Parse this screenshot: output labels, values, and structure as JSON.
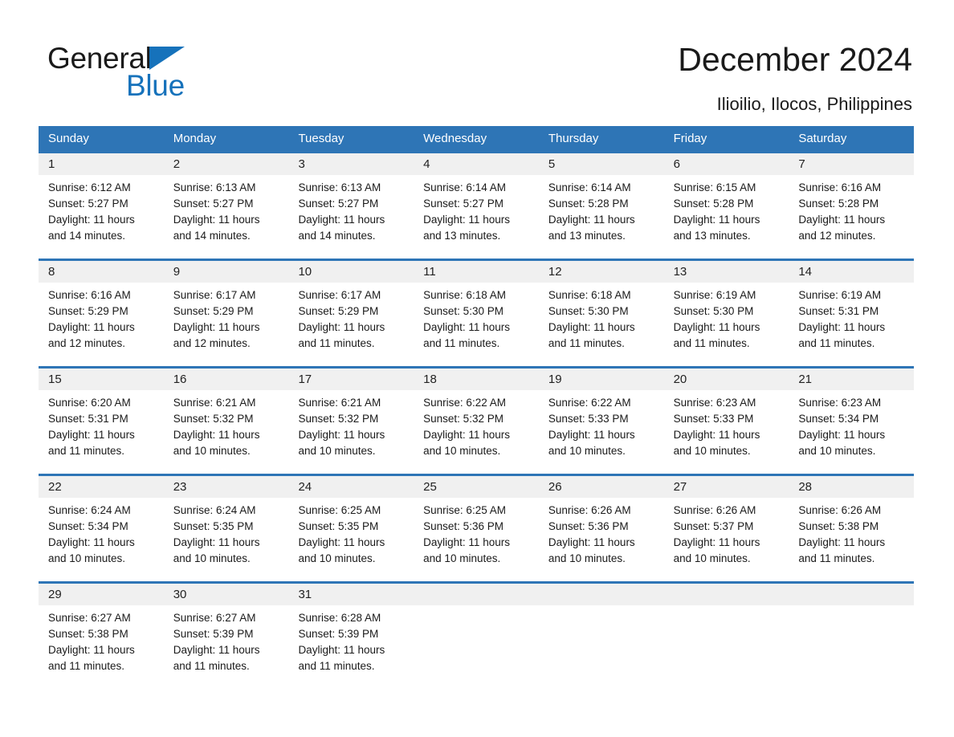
{
  "brand": {
    "word1": "General",
    "word2": "Blue",
    "triangle_color": "#1672bb",
    "text_color": "#1a1a1a"
  },
  "header": {
    "title": "December 2024",
    "subtitle": "Ilioilio, Ilocos, Philippines"
  },
  "colors": {
    "header_blue": "#2e75b6",
    "daynum_band": "#f0f0f0",
    "text": "#1a1a1a",
    "header_text": "#ffffff"
  },
  "weekdays": [
    "Sunday",
    "Monday",
    "Tuesday",
    "Wednesday",
    "Thursday",
    "Friday",
    "Saturday"
  ],
  "weeks": [
    {
      "days": [
        {
          "num": "1",
          "sunrise": "Sunrise: 6:12 AM",
          "sunset": "Sunset: 5:27 PM",
          "daylight1": "Daylight: 11 hours",
          "daylight2": "and 14 minutes."
        },
        {
          "num": "2",
          "sunrise": "Sunrise: 6:13 AM",
          "sunset": "Sunset: 5:27 PM",
          "daylight1": "Daylight: 11 hours",
          "daylight2": "and 14 minutes."
        },
        {
          "num": "3",
          "sunrise": "Sunrise: 6:13 AM",
          "sunset": "Sunset: 5:27 PM",
          "daylight1": "Daylight: 11 hours",
          "daylight2": "and 14 minutes."
        },
        {
          "num": "4",
          "sunrise": "Sunrise: 6:14 AM",
          "sunset": "Sunset: 5:27 PM",
          "daylight1": "Daylight: 11 hours",
          "daylight2": "and 13 minutes."
        },
        {
          "num": "5",
          "sunrise": "Sunrise: 6:14 AM",
          "sunset": "Sunset: 5:28 PM",
          "daylight1": "Daylight: 11 hours",
          "daylight2": "and 13 minutes."
        },
        {
          "num": "6",
          "sunrise": "Sunrise: 6:15 AM",
          "sunset": "Sunset: 5:28 PM",
          "daylight1": "Daylight: 11 hours",
          "daylight2": "and 13 minutes."
        },
        {
          "num": "7",
          "sunrise": "Sunrise: 6:16 AM",
          "sunset": "Sunset: 5:28 PM",
          "daylight1": "Daylight: 11 hours",
          "daylight2": "and 12 minutes."
        }
      ]
    },
    {
      "days": [
        {
          "num": "8",
          "sunrise": "Sunrise: 6:16 AM",
          "sunset": "Sunset: 5:29 PM",
          "daylight1": "Daylight: 11 hours",
          "daylight2": "and 12 minutes."
        },
        {
          "num": "9",
          "sunrise": "Sunrise: 6:17 AM",
          "sunset": "Sunset: 5:29 PM",
          "daylight1": "Daylight: 11 hours",
          "daylight2": "and 12 minutes."
        },
        {
          "num": "10",
          "sunrise": "Sunrise: 6:17 AM",
          "sunset": "Sunset: 5:29 PM",
          "daylight1": "Daylight: 11 hours",
          "daylight2": "and 11 minutes."
        },
        {
          "num": "11",
          "sunrise": "Sunrise: 6:18 AM",
          "sunset": "Sunset: 5:30 PM",
          "daylight1": "Daylight: 11 hours",
          "daylight2": "and 11 minutes."
        },
        {
          "num": "12",
          "sunrise": "Sunrise: 6:18 AM",
          "sunset": "Sunset: 5:30 PM",
          "daylight1": "Daylight: 11 hours",
          "daylight2": "and 11 minutes."
        },
        {
          "num": "13",
          "sunrise": "Sunrise: 6:19 AM",
          "sunset": "Sunset: 5:30 PM",
          "daylight1": "Daylight: 11 hours",
          "daylight2": "and 11 minutes."
        },
        {
          "num": "14",
          "sunrise": "Sunrise: 6:19 AM",
          "sunset": "Sunset: 5:31 PM",
          "daylight1": "Daylight: 11 hours",
          "daylight2": "and 11 minutes."
        }
      ]
    },
    {
      "days": [
        {
          "num": "15",
          "sunrise": "Sunrise: 6:20 AM",
          "sunset": "Sunset: 5:31 PM",
          "daylight1": "Daylight: 11 hours",
          "daylight2": "and 11 minutes."
        },
        {
          "num": "16",
          "sunrise": "Sunrise: 6:21 AM",
          "sunset": "Sunset: 5:32 PM",
          "daylight1": "Daylight: 11 hours",
          "daylight2": "and 10 minutes."
        },
        {
          "num": "17",
          "sunrise": "Sunrise: 6:21 AM",
          "sunset": "Sunset: 5:32 PM",
          "daylight1": "Daylight: 11 hours",
          "daylight2": "and 10 minutes."
        },
        {
          "num": "18",
          "sunrise": "Sunrise: 6:22 AM",
          "sunset": "Sunset: 5:32 PM",
          "daylight1": "Daylight: 11 hours",
          "daylight2": "and 10 minutes."
        },
        {
          "num": "19",
          "sunrise": "Sunrise: 6:22 AM",
          "sunset": "Sunset: 5:33 PM",
          "daylight1": "Daylight: 11 hours",
          "daylight2": "and 10 minutes."
        },
        {
          "num": "20",
          "sunrise": "Sunrise: 6:23 AM",
          "sunset": "Sunset: 5:33 PM",
          "daylight1": "Daylight: 11 hours",
          "daylight2": "and 10 minutes."
        },
        {
          "num": "21",
          "sunrise": "Sunrise: 6:23 AM",
          "sunset": "Sunset: 5:34 PM",
          "daylight1": "Daylight: 11 hours",
          "daylight2": "and 10 minutes."
        }
      ]
    },
    {
      "days": [
        {
          "num": "22",
          "sunrise": "Sunrise: 6:24 AM",
          "sunset": "Sunset: 5:34 PM",
          "daylight1": "Daylight: 11 hours",
          "daylight2": "and 10 minutes."
        },
        {
          "num": "23",
          "sunrise": "Sunrise: 6:24 AM",
          "sunset": "Sunset: 5:35 PM",
          "daylight1": "Daylight: 11 hours",
          "daylight2": "and 10 minutes."
        },
        {
          "num": "24",
          "sunrise": "Sunrise: 6:25 AM",
          "sunset": "Sunset: 5:35 PM",
          "daylight1": "Daylight: 11 hours",
          "daylight2": "and 10 minutes."
        },
        {
          "num": "25",
          "sunrise": "Sunrise: 6:25 AM",
          "sunset": "Sunset: 5:36 PM",
          "daylight1": "Daylight: 11 hours",
          "daylight2": "and 10 minutes."
        },
        {
          "num": "26",
          "sunrise": "Sunrise: 6:26 AM",
          "sunset": "Sunset: 5:36 PM",
          "daylight1": "Daylight: 11 hours",
          "daylight2": "and 10 minutes."
        },
        {
          "num": "27",
          "sunrise": "Sunrise: 6:26 AM",
          "sunset": "Sunset: 5:37 PM",
          "daylight1": "Daylight: 11 hours",
          "daylight2": "and 10 minutes."
        },
        {
          "num": "28",
          "sunrise": "Sunrise: 6:26 AM",
          "sunset": "Sunset: 5:38 PM",
          "daylight1": "Daylight: 11 hours",
          "daylight2": "and 11 minutes."
        }
      ]
    },
    {
      "days": [
        {
          "num": "29",
          "sunrise": "Sunrise: 6:27 AM",
          "sunset": "Sunset: 5:38 PM",
          "daylight1": "Daylight: 11 hours",
          "daylight2": "and 11 minutes."
        },
        {
          "num": "30",
          "sunrise": "Sunrise: 6:27 AM",
          "sunset": "Sunset: 5:39 PM",
          "daylight1": "Daylight: 11 hours",
          "daylight2": "and 11 minutes."
        },
        {
          "num": "31",
          "sunrise": "Sunrise: 6:28 AM",
          "sunset": "Sunset: 5:39 PM",
          "daylight1": "Daylight: 11 hours",
          "daylight2": "and 11 minutes."
        },
        {
          "num": "",
          "sunrise": "",
          "sunset": "",
          "daylight1": "",
          "daylight2": ""
        },
        {
          "num": "",
          "sunrise": "",
          "sunset": "",
          "daylight1": "",
          "daylight2": ""
        },
        {
          "num": "",
          "sunrise": "",
          "sunset": "",
          "daylight1": "",
          "daylight2": ""
        },
        {
          "num": "",
          "sunrise": "",
          "sunset": "",
          "daylight1": "",
          "daylight2": ""
        }
      ]
    }
  ]
}
